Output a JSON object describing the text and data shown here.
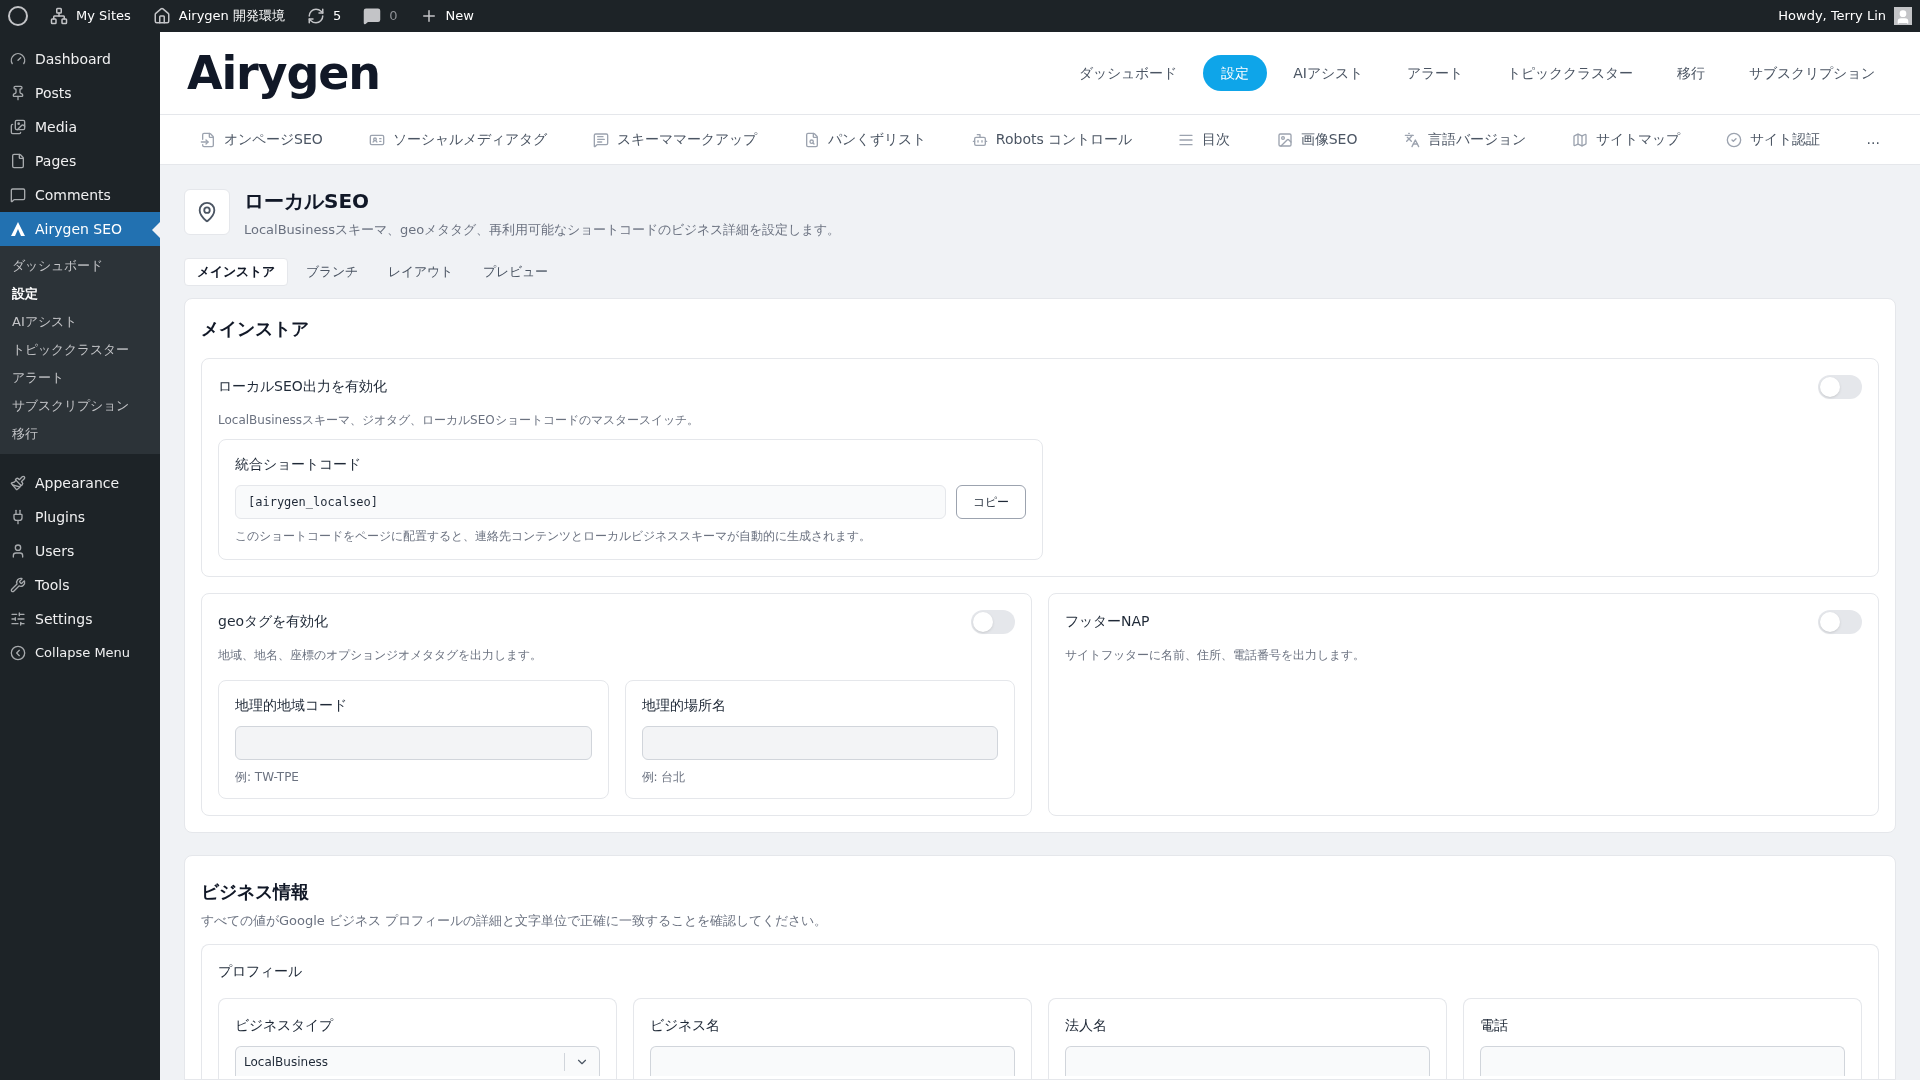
{
  "admin_bar": {
    "items": [
      {
        "kind": "wp"
      },
      {
        "kind": "sites",
        "label": "My Sites"
      },
      {
        "kind": "home",
        "label": "Airygen 開発環境"
      },
      {
        "kind": "updates",
        "label": "5"
      },
      {
        "kind": "comments",
        "label": "0"
      },
      {
        "kind": "new",
        "label": "New"
      }
    ],
    "greeting": "Howdy, Terry Lin"
  },
  "sidebar": {
    "items": [
      {
        "kind": "dashboard",
        "label": "Dashboard",
        "selected": false
      },
      {
        "kind": "posts",
        "label": "Posts",
        "selected": false
      },
      {
        "kind": "media",
        "label": "Media",
        "selected": false
      },
      {
        "kind": "pages",
        "label": "Pages",
        "selected": false
      },
      {
        "kind": "comments",
        "label": "Comments",
        "selected": false
      },
      {
        "kind": "airygen",
        "label": "Airygen SEO",
        "selected": true,
        "children": [
          {
            "label": "ダッシュボード",
            "selected": false
          },
          {
            "label": "設定",
            "selected": true
          },
          {
            "label": "AIアシスト",
            "selected": false
          },
          {
            "label": "トピッククラスター",
            "selected": false
          },
          {
            "label": "アラート",
            "selected": false
          },
          {
            "label": "サブスクリプション",
            "selected": false
          },
          {
            "label": "移行",
            "selected": false
          }
        ]
      },
      {
        "kind": "appearance",
        "label": "Appearance",
        "selected": false
      },
      {
        "kind": "plugins",
        "label": "Plugins",
        "selected": false
      },
      {
        "kind": "users",
        "label": "Users",
        "selected": false
      },
      {
        "kind": "tools",
        "label": "Tools",
        "selected": false
      },
      {
        "kind": "settings",
        "label": "Settings",
        "selected": false
      },
      {
        "kind": "collapse",
        "label": "Collapse Menu",
        "selected": false
      }
    ]
  },
  "header": {
    "logo": "Airygen",
    "nav": [
      {
        "label": "ダッシュボード",
        "selected": false
      },
      {
        "label": "設定",
        "selected": true
      },
      {
        "label": "AIアシスト",
        "selected": false
      },
      {
        "label": "アラート",
        "selected": false
      },
      {
        "label": "トピッククラスター",
        "selected": false
      },
      {
        "label": "移行",
        "selected": false
      },
      {
        "label": "サブスクリプション",
        "selected": false
      }
    ]
  },
  "settings_tabs": [
    {
      "kind": "onpage",
      "label": "オンページSEO"
    },
    {
      "kind": "social",
      "label": "ソーシャルメディアタグ"
    },
    {
      "kind": "schema",
      "label": "スキーママークアップ"
    },
    {
      "kind": "breadcrumb",
      "label": "パンくずリスト"
    },
    {
      "kind": "robots",
      "label": "Robots コントロール"
    },
    {
      "kind": "toc",
      "label": "目次"
    },
    {
      "kind": "image",
      "label": "画像SEO"
    },
    {
      "kind": "language",
      "label": "言語バージョン"
    },
    {
      "kind": "sitemap",
      "label": "サイトマップ"
    },
    {
      "kind": "verify",
      "label": "サイト認証"
    },
    {
      "kind": "more",
      "label": "..."
    }
  ],
  "page": {
    "title": "ローカルSEO",
    "description": "LocalBusinessスキーマ、geoメタタグ、再利用可能なショートコードのビジネス詳細を設定します。"
  },
  "sub_tabs": [
    {
      "label": "メインストア",
      "selected": true
    },
    {
      "label": "ブランチ",
      "selected": false
    },
    {
      "label": "レイアウト",
      "selected": false
    },
    {
      "label": "プレビュー",
      "selected": false
    }
  ],
  "main_store": {
    "title": "メインストア",
    "enable": {
      "label": "ローカルSEO出力を有効化",
      "on": false,
      "description": "LocalBusinessスキーマ、ジオタグ、ローカルSEOショートコードのマスタースイッチ。"
    },
    "shortcode": {
      "label": "統合ショートコード",
      "value": "[airygen_localseo]",
      "button": "コピー",
      "help": "このショートコードをページに配置すると、連絡先コンテンツとローカルビジネススキーマが自動的に生成されます。"
    },
    "geo": {
      "label": "geoタグを有効化",
      "on": false,
      "description": "地域、地名、座標のオプションジオメタタグを出力します。",
      "fields": [
        {
          "label": "地理的地域コード",
          "hint": "例: TW-TPE"
        },
        {
          "label": "地理的場所名",
          "hint": "例: 台北"
        }
      ]
    },
    "footer_nap": {
      "label": "フッターNAP",
      "on": false,
      "description": "サイトフッターに名前、住所、電話番号を出力します。"
    }
  },
  "business": {
    "title": "ビジネス情報",
    "description": "すべての値がGoogle ビジネス プロフィールの詳細と文字単位で正確に一致することを確認してください。",
    "profile_title": "プロフィール",
    "fields": [
      {
        "kind": "select",
        "label": "ビジネスタイプ",
        "value": "LocalBusiness"
      },
      {
        "kind": "text",
        "label": "ビジネス名"
      },
      {
        "kind": "text",
        "label": "法人名"
      },
      {
        "kind": "text",
        "label": "電話"
      }
    ]
  }
}
